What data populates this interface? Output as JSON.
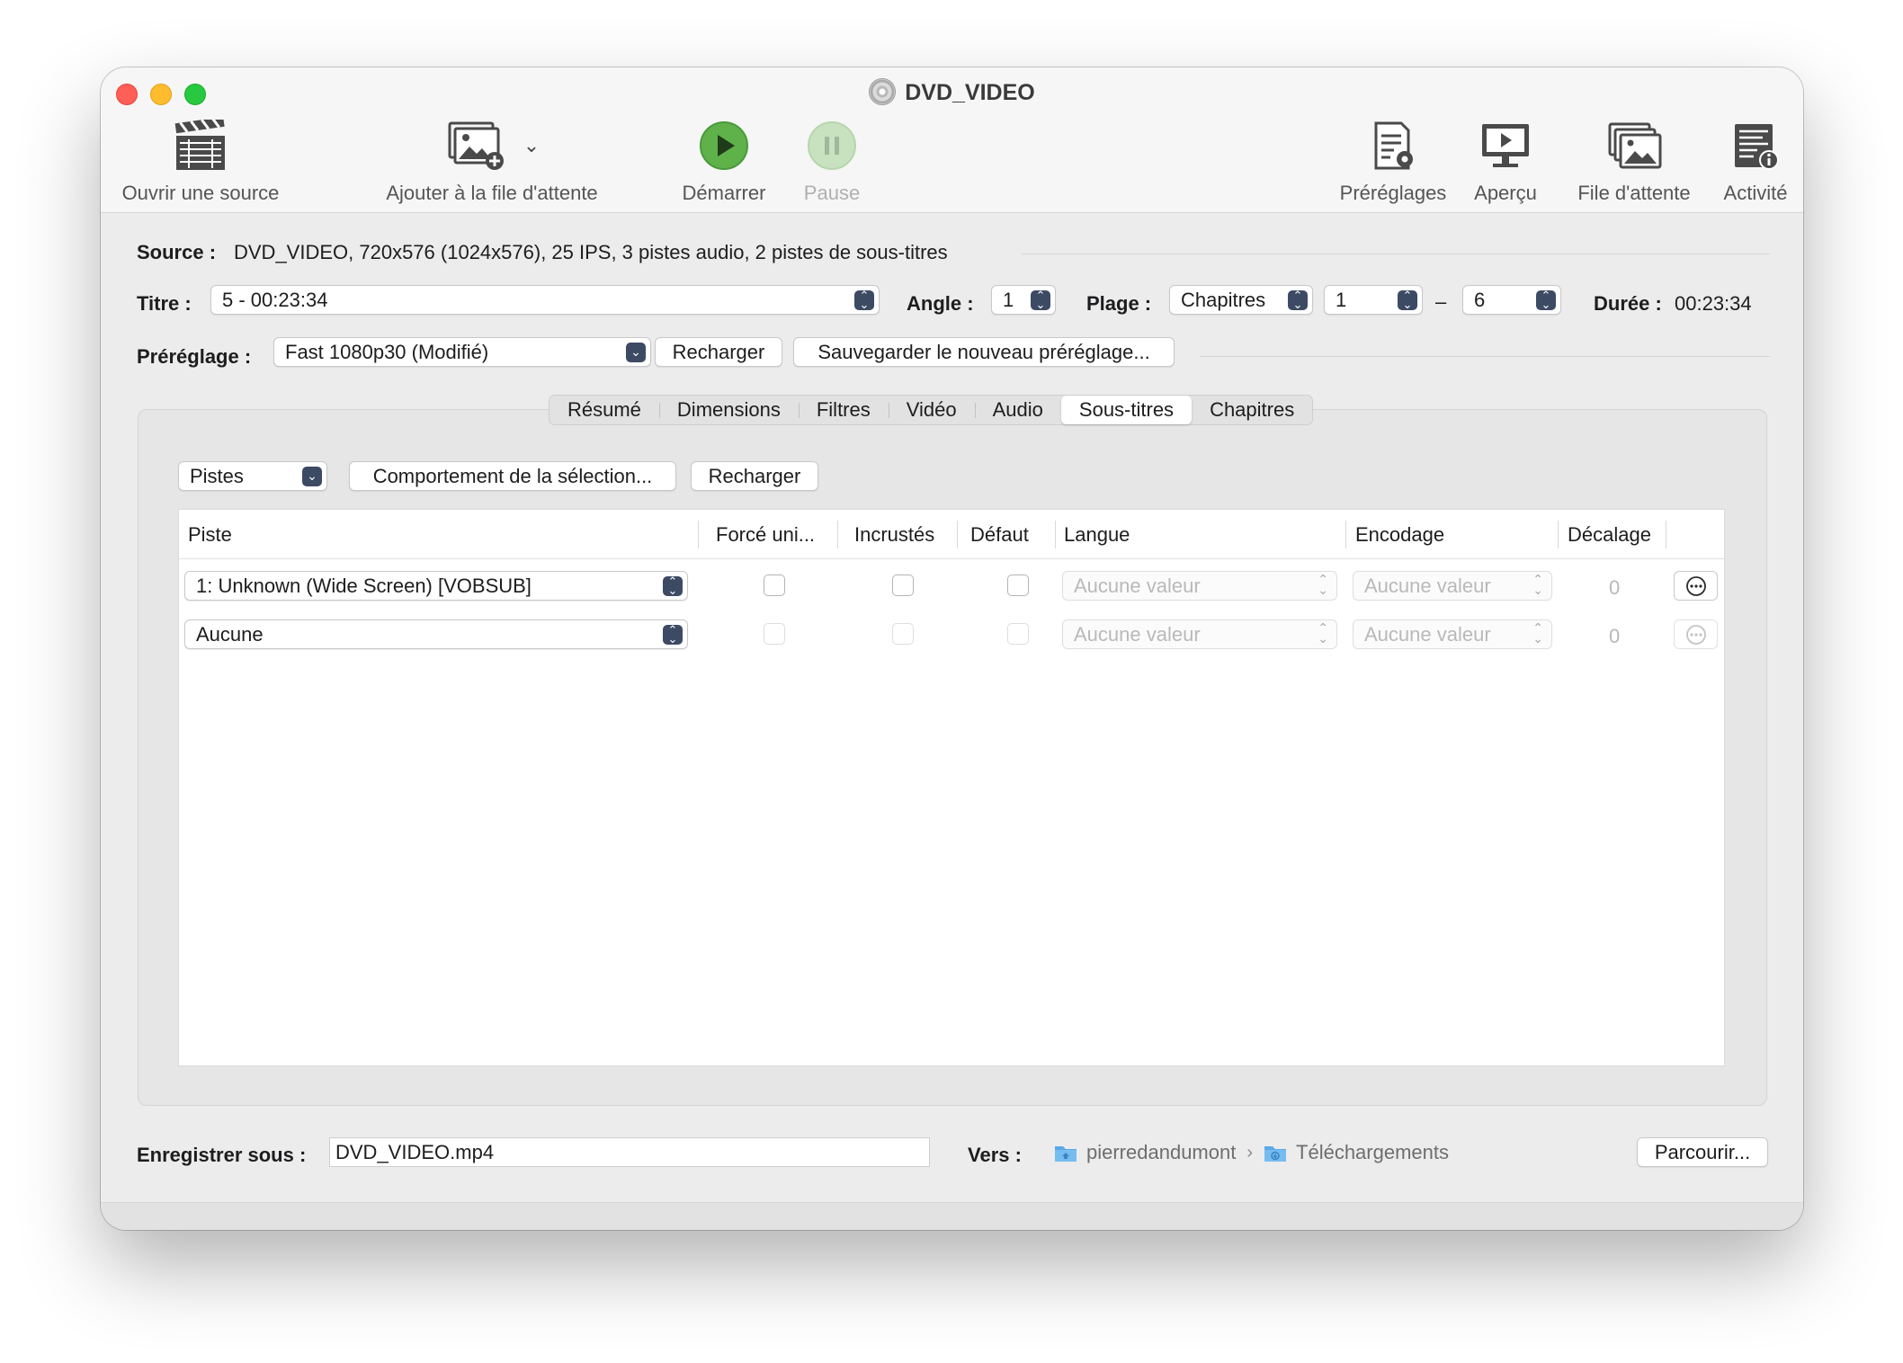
{
  "window": {
    "title": "DVD_VIDEO"
  },
  "toolbar": {
    "open_source": "Ouvrir une source",
    "add_to_queue": "Ajouter à la file d'attente",
    "start": "Démarrer",
    "pause": "Pause",
    "presets": "Préréglages",
    "preview": "Aperçu",
    "queue": "File d'attente",
    "activity": "Activité"
  },
  "source": {
    "label": "Source :",
    "value": "DVD_VIDEO, 720x576 (1024x576), 25 IPS, 3 pistes audio, 2 pistes de sous-titres"
  },
  "title_row": {
    "title_label": "Titre :",
    "title_value": "5 - 00:23:34",
    "angle_label": "Angle :",
    "angle_value": "1",
    "range_label": "Plage :",
    "range_type": "Chapitres",
    "range_start": "1",
    "range_dash": "–",
    "range_end": "6",
    "duration_label": "Durée :",
    "duration_value": "00:23:34"
  },
  "preset_row": {
    "label": "Préréglage :",
    "value": "Fast 1080p30 (Modifié)",
    "reload": "Recharger",
    "save_new": "Sauvegarder le nouveau préréglage..."
  },
  "tabs": [
    "Résumé",
    "Dimensions",
    "Filtres",
    "Vidéo",
    "Audio",
    "Sous-titres",
    "Chapitres"
  ],
  "active_tab": "Sous-titres",
  "subtitles": {
    "tracks_popup": "Pistes",
    "selection_behavior": "Comportement de la sélection...",
    "reload": "Recharger",
    "columns": {
      "track": "Piste",
      "forced": "Forcé uni...",
      "burned": "Incrustés",
      "default": "Défaut",
      "language": "Langue",
      "encoding": "Encodage",
      "offset": "Décalage"
    },
    "rows": [
      {
        "track": "1: Unknown (Wide Screen) [VOBSUB]",
        "language": "Aucune valeur",
        "encoding": "Aucune valeur",
        "offset": "0"
      },
      {
        "track": "Aucune",
        "language": "Aucune valeur",
        "encoding": "Aucune valeur",
        "offset": "0"
      }
    ]
  },
  "footer": {
    "save_as_label": "Enregistrer sous :",
    "save_as_value": "DVD_VIDEO.mp4",
    "to_label": "Vers :",
    "path": [
      "pierredandumont",
      "Téléchargements"
    ],
    "browse": "Parcourir..."
  },
  "colors": {
    "accent": "#3d4a64",
    "start_green": "#5fb24a",
    "close": "#ff5f57",
    "minimize": "#febc2e",
    "zoom": "#28c840",
    "folder_blue": "#5aa9e6"
  },
  "icons": {
    "open_source": "clapperboard-icon",
    "add_to_queue": "add-image-icon",
    "start": "play-icon",
    "pause": "pause-icon",
    "presets": "presets-gear-icon",
    "preview": "monitor-play-icon",
    "queue": "stacked-images-icon",
    "activity": "log-info-icon"
  }
}
